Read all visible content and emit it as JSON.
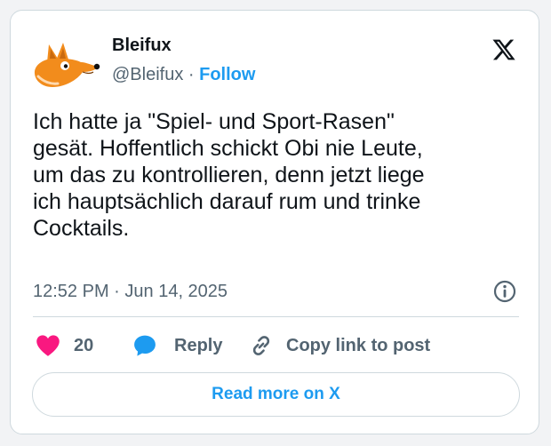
{
  "author": {
    "display_name": "Bleifux",
    "handle": "@Bleifux",
    "separator": " · ",
    "follow_label": "Follow"
  },
  "tweet": {
    "text": "Ich hatte ja \"Spiel- und Sport-Rasen\"\ngesät. Hoffentlich schickt Obi nie Leute,\num das zu kontrollieren, denn jetzt liege\nich hauptsächlich darauf rum und trinke\nCocktails.",
    "time": "12:52 PM",
    "separator": " · ",
    "date": "Jun 14, 2025"
  },
  "actions": {
    "like_count": "20",
    "reply_label": "Reply",
    "copy_label": "Copy link to post"
  },
  "read_more_label": "Read more on X",
  "colors": {
    "accent": "#1d9bf0",
    "like": "#f91880",
    "muted": "#536471",
    "border": "#cfd9de",
    "text": "#0f1419"
  },
  "icons": {
    "avatar": "orange-fox-avatar",
    "brand": "x-logo-icon",
    "info": "info-icon",
    "like": "heart-icon",
    "reply": "speech-bubble-icon",
    "copy": "link-icon"
  }
}
